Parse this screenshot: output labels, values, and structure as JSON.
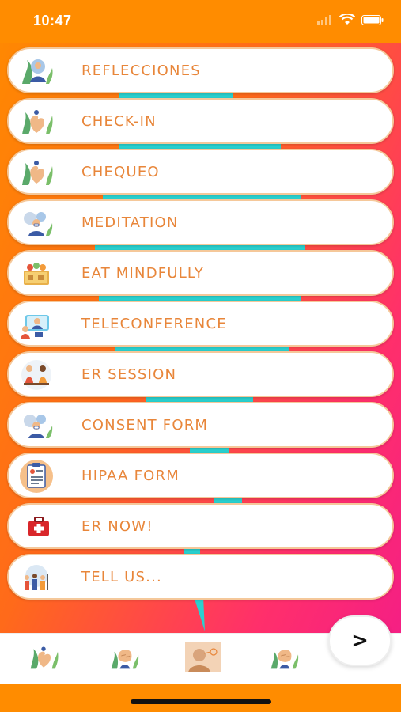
{
  "status_bar": {
    "time": "10:47"
  },
  "menu": {
    "items": [
      {
        "label": "REFLECCIONES",
        "icon": "meditating-figure-icon"
      },
      {
        "label": "CHECK-IN",
        "icon": "heart-plant-icon"
      },
      {
        "label": "CHEQUEO",
        "icon": "heart-plant-icon"
      },
      {
        "label": "MEDITATION",
        "icon": "person-with-mask-icon"
      },
      {
        "label": "EAT MINDFULLY",
        "icon": "food-basket-icon"
      },
      {
        "label": "TELECONFERENCE",
        "icon": "video-call-icon"
      },
      {
        "label": "ER SESSION",
        "icon": "two-people-talking-icon"
      },
      {
        "label": "CONSENT FORM",
        "icon": "person-with-mask-icon"
      },
      {
        "label": "HIPAA FORM",
        "icon": "clipboard-form-icon"
      },
      {
        "label": "ER NOW!",
        "icon": "first-aid-kit-icon"
      },
      {
        "label": "TELL US...",
        "icon": "group-people-icon"
      }
    ]
  },
  "bottom_tabs": [
    {
      "icon": "heart-plant-icon"
    },
    {
      "icon": "brain-icon"
    },
    {
      "icon": "person-profile-icon"
    },
    {
      "icon": "brain-icon"
    }
  ],
  "next_button": {
    "label": ">"
  }
}
